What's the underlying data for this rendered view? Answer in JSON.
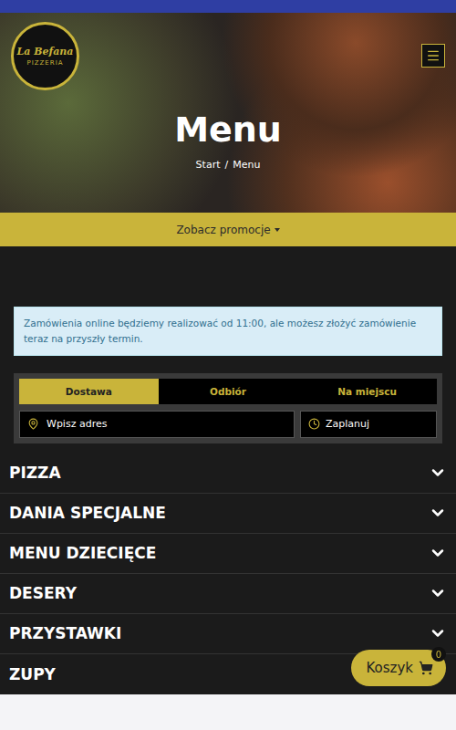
{
  "header": {
    "logo": {
      "name": "La Befana",
      "subtitle": "PIZZERIA"
    },
    "title": "Menu",
    "breadcrumb": [
      {
        "label": "Start"
      },
      {
        "label": "Menu"
      }
    ],
    "breadcrumb_separator": "/"
  },
  "promo": {
    "label": "Zobacz promocje",
    "expanded": false
  },
  "notice": "Zamówienia online będziemy realizować od 11:00, ale możesz złożyć zamówienie teraz na przyszły termin.",
  "order_modes": [
    {
      "label": "Dostawa",
      "selected": true
    },
    {
      "label": "Odbiór",
      "selected": false
    },
    {
      "label": "Na miejscu",
      "selected": false
    }
  ],
  "address": {
    "placeholder": "Wpisz adres"
  },
  "schedule": {
    "label": "Zaplanuj"
  },
  "categories": [
    {
      "name": "PIZZA",
      "expanded": false
    },
    {
      "name": "DANIA SPECJALNE",
      "expanded": false
    },
    {
      "name": "MENU DZIECIĘCE",
      "expanded": false
    },
    {
      "name": "DESERY",
      "expanded": false
    },
    {
      "name": "PRZYSTAWKI",
      "expanded": false
    },
    {
      "name": "ZUPY",
      "expanded": false
    }
  ],
  "cart": {
    "label": "Koszyk",
    "count": "0"
  }
}
